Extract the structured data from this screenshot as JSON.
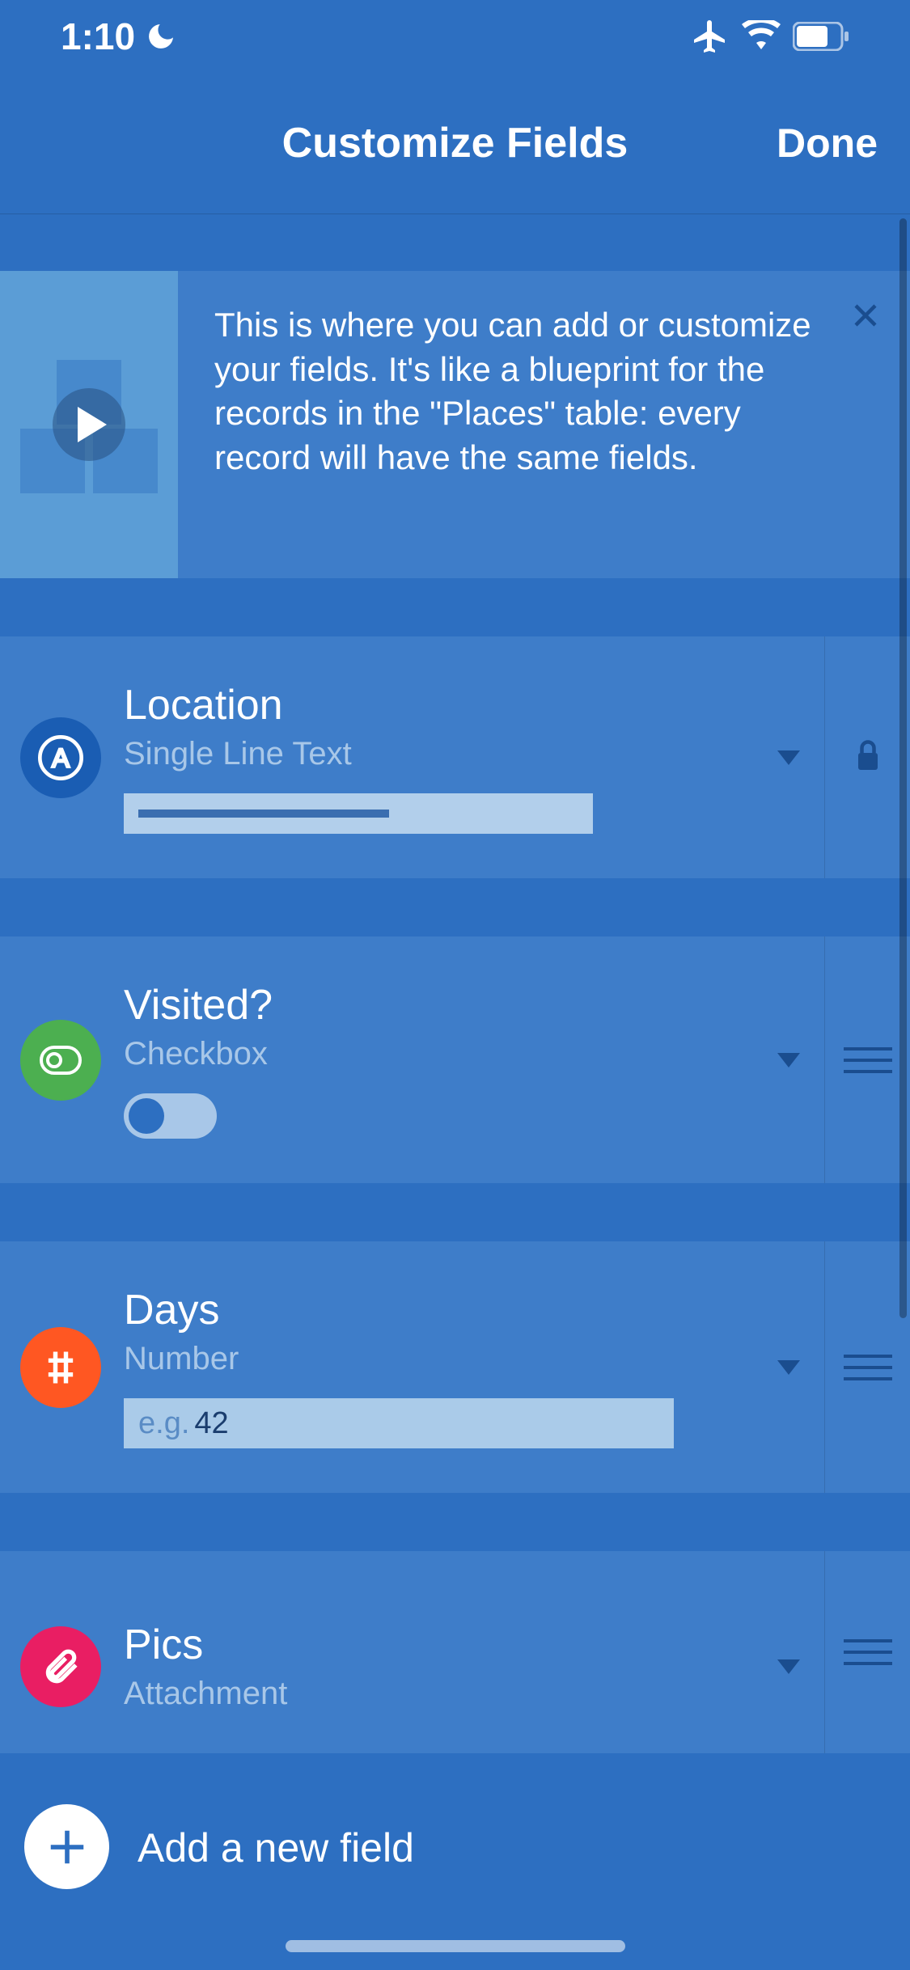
{
  "status": {
    "time": "1:10"
  },
  "nav": {
    "title": "Customize Fields",
    "done": "Done"
  },
  "info": {
    "text": "This is where you can add or customize your fields. It's like a blueprint for the records in the \"Places\" table: every record will have the same fields."
  },
  "fields": [
    {
      "name": "Location",
      "type": "Single Line Text",
      "locked": true
    },
    {
      "name": "Visited?",
      "type": "Checkbox",
      "locked": false
    },
    {
      "name": "Days",
      "type": "Number",
      "locked": false,
      "example_prefix": "e.g.",
      "example_value": "42"
    },
    {
      "name": "Pics",
      "type": "Attachment",
      "locked": false
    }
  ],
  "add": {
    "label": "Add a new field"
  }
}
